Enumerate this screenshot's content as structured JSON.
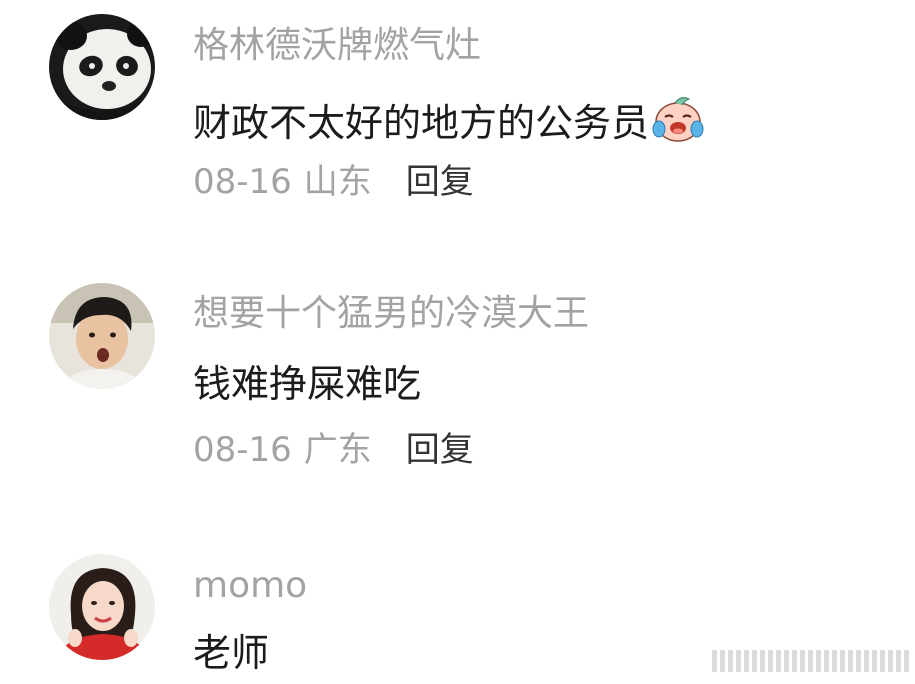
{
  "comments": [
    {
      "username": "格林德沃牌燃气灶",
      "text": "财政不太好的地方的公务员",
      "emoji": "crying-laughing-emoji",
      "date": "08-16",
      "region": "山东",
      "reply_label": "回复",
      "avatar": "panda-avatar"
    },
    {
      "username": "想要十个猛男的冷漠大王",
      "text": "钱难挣屎难吃",
      "date": "08-16",
      "region": "广东",
      "reply_label": "回复",
      "avatar": "young-man-avatar"
    },
    {
      "username": "momo",
      "text": "老师",
      "avatar": "young-woman-avatar"
    }
  ],
  "colors": {
    "username": "#a3a3a3",
    "text": "#1c1c1c",
    "meta": "#a3a3a3",
    "reply": "#333333",
    "background": "#ffffff"
  }
}
